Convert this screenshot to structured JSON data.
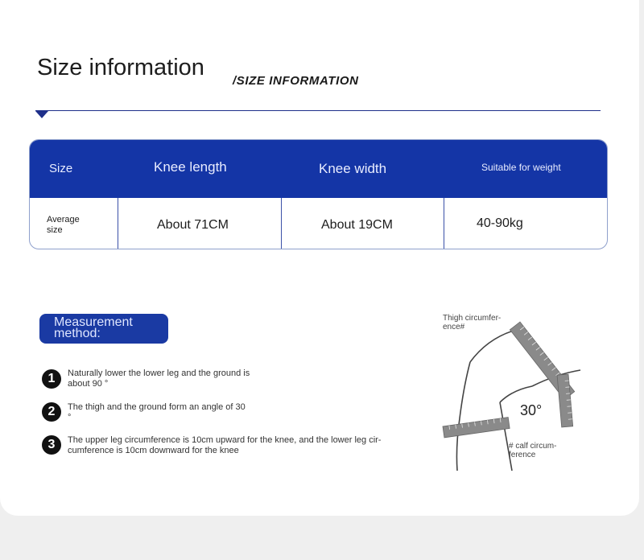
{
  "header": {
    "title": "Size information",
    "subtitle": "/SIZE INFORMATION"
  },
  "size_table": {
    "headers": [
      "Size",
      "Knee length",
      "Knee width",
      "Suitable for weight"
    ],
    "row": {
      "label": "Average size",
      "knee_length": "About 71CM",
      "knee_width": "About 19CM",
      "weight": "40-90kg"
    }
  },
  "measurement": {
    "title": "Measurement method:",
    "steps": [
      {
        "number": "1",
        "text": "Naturally lower the lower leg and the ground is about 90 °"
      },
      {
        "number": "2",
        "text": "The thigh and the ground form an angle of 30 °"
      },
      {
        "number": "3",
        "text": "The upper leg circumference is 10cm upward for the knee, and the lower leg cir-cumference is 10cm downward for the knee"
      }
    ]
  },
  "illustration": {
    "thigh_label": "Thigh circumfer-ence#",
    "angle_label": "30°",
    "calf_label": "# calf circum-ference"
  },
  "colors": {
    "accent": "#1435a6",
    "rule": "#1e2f8a"
  }
}
